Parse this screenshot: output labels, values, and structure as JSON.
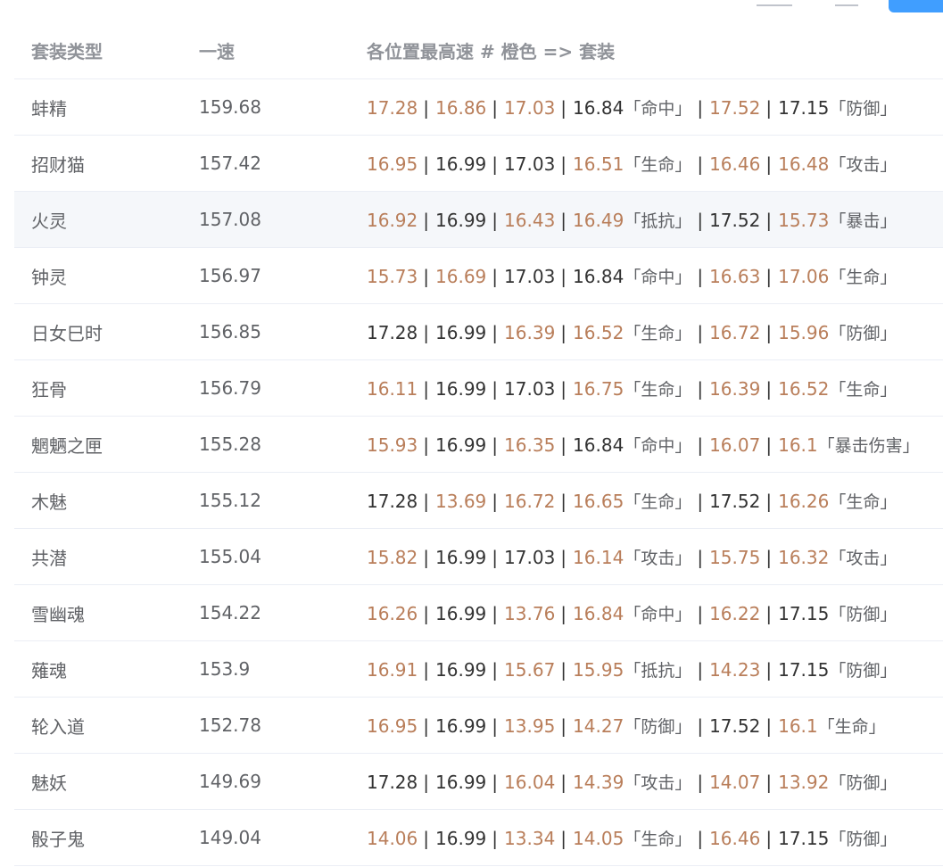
{
  "colors": {
    "orange": "#b97e5a",
    "dark": "#333333",
    "header": "#909399",
    "accent_blue": "#409eff"
  },
  "table": {
    "headers": {
      "type": "套装类型",
      "speed": "一速",
      "detail": "各位置最高速 # 橙色 => 套装"
    },
    "rows": [
      {
        "name": "蚌精",
        "speed": "159.68",
        "slots": [
          {
            "v": "17.28",
            "o": true
          },
          {
            "v": "16.86",
            "o": true
          },
          {
            "v": "17.03",
            "o": true
          },
          {
            "v": "16.84",
            "o": false,
            "tag": "「命中」"
          },
          {
            "v": "17.52",
            "o": true
          },
          {
            "v": "17.15",
            "o": false,
            "tag": "「防御」"
          }
        ]
      },
      {
        "name": "招财猫",
        "speed": "157.42",
        "slots": [
          {
            "v": "16.95",
            "o": true
          },
          {
            "v": "16.99",
            "o": false
          },
          {
            "v": "17.03",
            "o": false
          },
          {
            "v": "16.51",
            "o": true,
            "tag": "「生命」"
          },
          {
            "v": "16.46",
            "o": true
          },
          {
            "v": "16.48",
            "o": true,
            "tag": "「攻击」"
          }
        ]
      },
      {
        "name": "火灵",
        "speed": "157.08",
        "hover": true,
        "slots": [
          {
            "v": "16.92",
            "o": true
          },
          {
            "v": "16.99",
            "o": false
          },
          {
            "v": "16.43",
            "o": true
          },
          {
            "v": "16.49",
            "o": true,
            "tag": "「抵抗」"
          },
          {
            "v": "17.52",
            "o": false
          },
          {
            "v": "15.73",
            "o": true,
            "tag": "「暴击」"
          }
        ]
      },
      {
        "name": "钟灵",
        "speed": "156.97",
        "slots": [
          {
            "v": "15.73",
            "o": true
          },
          {
            "v": "16.69",
            "o": true
          },
          {
            "v": "17.03",
            "o": false
          },
          {
            "v": "16.84",
            "o": false,
            "tag": "「命中」"
          },
          {
            "v": "16.63",
            "o": true
          },
          {
            "v": "17.06",
            "o": true,
            "tag": "「生命」"
          }
        ]
      },
      {
        "name": "日女巳时",
        "speed": "156.85",
        "slots": [
          {
            "v": "17.28",
            "o": false
          },
          {
            "v": "16.99",
            "o": false
          },
          {
            "v": "16.39",
            "o": true
          },
          {
            "v": "16.52",
            "o": true,
            "tag": "「生命」"
          },
          {
            "v": "16.72",
            "o": true
          },
          {
            "v": "15.96",
            "o": true,
            "tag": "「防御」"
          }
        ]
      },
      {
        "name": "狂骨",
        "speed": "156.79",
        "slots": [
          {
            "v": "16.11",
            "o": true
          },
          {
            "v": "16.99",
            "o": false
          },
          {
            "v": "17.03",
            "o": false
          },
          {
            "v": "16.75",
            "o": true,
            "tag": "「生命」"
          },
          {
            "v": "16.39",
            "o": true
          },
          {
            "v": "16.52",
            "o": true,
            "tag": "「生命」"
          }
        ]
      },
      {
        "name": "魍魉之匣",
        "speed": "155.28",
        "slots": [
          {
            "v": "15.93",
            "o": true
          },
          {
            "v": "16.99",
            "o": false
          },
          {
            "v": "16.35",
            "o": true
          },
          {
            "v": "16.84",
            "o": false,
            "tag": "「命中」"
          },
          {
            "v": "16.07",
            "o": true
          },
          {
            "v": "16.1",
            "o": true,
            "tag": "「暴击伤害」"
          }
        ]
      },
      {
        "name": "木魅",
        "speed": "155.12",
        "slots": [
          {
            "v": "17.28",
            "o": false
          },
          {
            "v": "13.69",
            "o": true
          },
          {
            "v": "16.72",
            "o": true
          },
          {
            "v": "16.65",
            "o": true,
            "tag": "「生命」"
          },
          {
            "v": "17.52",
            "o": false
          },
          {
            "v": "16.26",
            "o": true,
            "tag": "「生命」"
          }
        ]
      },
      {
        "name": "共潜",
        "speed": "155.04",
        "slots": [
          {
            "v": "15.82",
            "o": true
          },
          {
            "v": "16.99",
            "o": false
          },
          {
            "v": "17.03",
            "o": false
          },
          {
            "v": "16.14",
            "o": true,
            "tag": "「攻击」"
          },
          {
            "v": "15.75",
            "o": true
          },
          {
            "v": "16.32",
            "o": true,
            "tag": "「攻击」"
          }
        ]
      },
      {
        "name": "雪幽魂",
        "speed": "154.22",
        "slots": [
          {
            "v": "16.26",
            "o": true
          },
          {
            "v": "16.99",
            "o": false
          },
          {
            "v": "13.76",
            "o": true
          },
          {
            "v": "16.84",
            "o": true,
            "tag": "「命中」"
          },
          {
            "v": "16.22",
            "o": true
          },
          {
            "v": "17.15",
            "o": false,
            "tag": "「防御」"
          }
        ]
      },
      {
        "name": "薙魂",
        "speed": "153.9",
        "slots": [
          {
            "v": "16.91",
            "o": true
          },
          {
            "v": "16.99",
            "o": false
          },
          {
            "v": "15.67",
            "o": true
          },
          {
            "v": "15.95",
            "o": true,
            "tag": "「抵抗」"
          },
          {
            "v": "14.23",
            "o": true
          },
          {
            "v": "17.15",
            "o": false,
            "tag": "「防御」"
          }
        ]
      },
      {
        "name": "轮入道",
        "speed": "152.78",
        "slots": [
          {
            "v": "16.95",
            "o": true
          },
          {
            "v": "16.99",
            "o": false
          },
          {
            "v": "13.95",
            "o": true
          },
          {
            "v": "14.27",
            "o": true,
            "tag": "「防御」"
          },
          {
            "v": "17.52",
            "o": false
          },
          {
            "v": "16.1",
            "o": true,
            "tag": "「生命」"
          }
        ]
      },
      {
        "name": "魅妖",
        "speed": "149.69",
        "slots": [
          {
            "v": "17.28",
            "o": false
          },
          {
            "v": "16.99",
            "o": false
          },
          {
            "v": "16.04",
            "o": true
          },
          {
            "v": "14.39",
            "o": true,
            "tag": "「攻击」"
          },
          {
            "v": "14.07",
            "o": true
          },
          {
            "v": "13.92",
            "o": true,
            "tag": "「防御」"
          }
        ]
      },
      {
        "name": "骰子鬼",
        "speed": "149.04",
        "slots": [
          {
            "v": "14.06",
            "o": true
          },
          {
            "v": "16.99",
            "o": false
          },
          {
            "v": "13.34",
            "o": true
          },
          {
            "v": "14.05",
            "o": true,
            "tag": "「生命」"
          },
          {
            "v": "16.46",
            "o": true
          },
          {
            "v": "17.15",
            "o": false,
            "tag": "「防御」"
          }
        ]
      }
    ]
  }
}
